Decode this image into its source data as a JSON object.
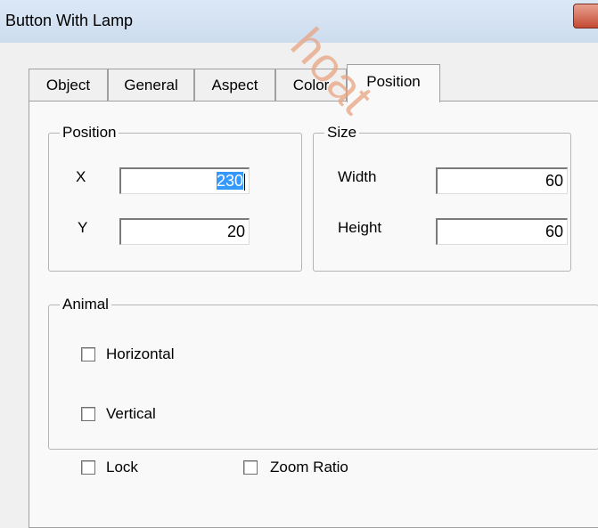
{
  "window": {
    "title": "Button With Lamp",
    "watermark": "hoat"
  },
  "tabs": [
    {
      "label": "Object"
    },
    {
      "label": "General"
    },
    {
      "label": "Aspect"
    },
    {
      "label": "Color"
    },
    {
      "label": "Position",
      "active": true
    }
  ],
  "position_group": {
    "legend": "Position",
    "x_label": "X",
    "x_value_selected": "230",
    "x_value_rest": "",
    "y_label": "Y",
    "y_value": "20"
  },
  "size_group": {
    "legend": "Size",
    "width_label": "Width",
    "width_value": "60",
    "height_label": "Height",
    "height_value": "60"
  },
  "animal_group": {
    "legend": "Animal",
    "horizontal_label": "Horizontal",
    "horizontal_checked": false,
    "vertical_label": "Vertical",
    "vertical_checked": false
  },
  "options": {
    "lock_label": "Lock",
    "lock_checked": false,
    "zoom_ratio_label": "Zoom Ratio",
    "zoom_ratio_checked": false
  }
}
